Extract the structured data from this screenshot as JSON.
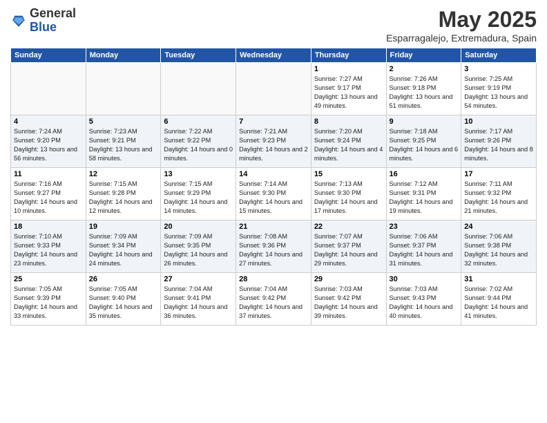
{
  "logo": {
    "general": "General",
    "blue": "Blue"
  },
  "title": "May 2025",
  "subtitle": "Esparragalejo, Extremadura, Spain",
  "days_of_week": [
    "Sunday",
    "Monday",
    "Tuesday",
    "Wednesday",
    "Thursday",
    "Friday",
    "Saturday"
  ],
  "weeks": [
    [
      {
        "day": "",
        "info": ""
      },
      {
        "day": "",
        "info": ""
      },
      {
        "day": "",
        "info": ""
      },
      {
        "day": "",
        "info": ""
      },
      {
        "day": "1",
        "info": "Sunrise: 7:27 AM\nSunset: 9:17 PM\nDaylight: 13 hours\nand 49 minutes."
      },
      {
        "day": "2",
        "info": "Sunrise: 7:26 AM\nSunset: 9:18 PM\nDaylight: 13 hours\nand 51 minutes."
      },
      {
        "day": "3",
        "info": "Sunrise: 7:25 AM\nSunset: 9:19 PM\nDaylight: 13 hours\nand 54 minutes."
      }
    ],
    [
      {
        "day": "4",
        "info": "Sunrise: 7:24 AM\nSunset: 9:20 PM\nDaylight: 13 hours\nand 56 minutes."
      },
      {
        "day": "5",
        "info": "Sunrise: 7:23 AM\nSunset: 9:21 PM\nDaylight: 13 hours\nand 58 minutes."
      },
      {
        "day": "6",
        "info": "Sunrise: 7:22 AM\nSunset: 9:22 PM\nDaylight: 14 hours\nand 0 minutes."
      },
      {
        "day": "7",
        "info": "Sunrise: 7:21 AM\nSunset: 9:23 PM\nDaylight: 14 hours\nand 2 minutes."
      },
      {
        "day": "8",
        "info": "Sunrise: 7:20 AM\nSunset: 9:24 PM\nDaylight: 14 hours\nand 4 minutes."
      },
      {
        "day": "9",
        "info": "Sunrise: 7:18 AM\nSunset: 9:25 PM\nDaylight: 14 hours\nand 6 minutes."
      },
      {
        "day": "10",
        "info": "Sunrise: 7:17 AM\nSunset: 9:26 PM\nDaylight: 14 hours\nand 8 minutes."
      }
    ],
    [
      {
        "day": "11",
        "info": "Sunrise: 7:16 AM\nSunset: 9:27 PM\nDaylight: 14 hours\nand 10 minutes."
      },
      {
        "day": "12",
        "info": "Sunrise: 7:15 AM\nSunset: 9:28 PM\nDaylight: 14 hours\nand 12 minutes."
      },
      {
        "day": "13",
        "info": "Sunrise: 7:15 AM\nSunset: 9:29 PM\nDaylight: 14 hours\nand 14 minutes."
      },
      {
        "day": "14",
        "info": "Sunrise: 7:14 AM\nSunset: 9:30 PM\nDaylight: 14 hours\nand 15 minutes."
      },
      {
        "day": "15",
        "info": "Sunrise: 7:13 AM\nSunset: 9:30 PM\nDaylight: 14 hours\nand 17 minutes."
      },
      {
        "day": "16",
        "info": "Sunrise: 7:12 AM\nSunset: 9:31 PM\nDaylight: 14 hours\nand 19 minutes."
      },
      {
        "day": "17",
        "info": "Sunrise: 7:11 AM\nSunset: 9:32 PM\nDaylight: 14 hours\nand 21 minutes."
      }
    ],
    [
      {
        "day": "18",
        "info": "Sunrise: 7:10 AM\nSunset: 9:33 PM\nDaylight: 14 hours\nand 23 minutes."
      },
      {
        "day": "19",
        "info": "Sunrise: 7:09 AM\nSunset: 9:34 PM\nDaylight: 14 hours\nand 24 minutes."
      },
      {
        "day": "20",
        "info": "Sunrise: 7:09 AM\nSunset: 9:35 PM\nDaylight: 14 hours\nand 26 minutes."
      },
      {
        "day": "21",
        "info": "Sunrise: 7:08 AM\nSunset: 9:36 PM\nDaylight: 14 hours\nand 27 minutes."
      },
      {
        "day": "22",
        "info": "Sunrise: 7:07 AM\nSunset: 9:37 PM\nDaylight: 14 hours\nand 29 minutes."
      },
      {
        "day": "23",
        "info": "Sunrise: 7:06 AM\nSunset: 9:37 PM\nDaylight: 14 hours\nand 31 minutes."
      },
      {
        "day": "24",
        "info": "Sunrise: 7:06 AM\nSunset: 9:38 PM\nDaylight: 14 hours\nand 32 minutes."
      }
    ],
    [
      {
        "day": "25",
        "info": "Sunrise: 7:05 AM\nSunset: 9:39 PM\nDaylight: 14 hours\nand 33 minutes."
      },
      {
        "day": "26",
        "info": "Sunrise: 7:05 AM\nSunset: 9:40 PM\nDaylight: 14 hours\nand 35 minutes."
      },
      {
        "day": "27",
        "info": "Sunrise: 7:04 AM\nSunset: 9:41 PM\nDaylight: 14 hours\nand 36 minutes."
      },
      {
        "day": "28",
        "info": "Sunrise: 7:04 AM\nSunset: 9:42 PM\nDaylight: 14 hours\nand 37 minutes."
      },
      {
        "day": "29",
        "info": "Sunrise: 7:03 AM\nSunset: 9:42 PM\nDaylight: 14 hours\nand 39 minutes."
      },
      {
        "day": "30",
        "info": "Sunrise: 7:03 AM\nSunset: 9:43 PM\nDaylight: 14 hours\nand 40 minutes."
      },
      {
        "day": "31",
        "info": "Sunrise: 7:02 AM\nSunset: 9:44 PM\nDaylight: 14 hours\nand 41 minutes."
      }
    ]
  ]
}
